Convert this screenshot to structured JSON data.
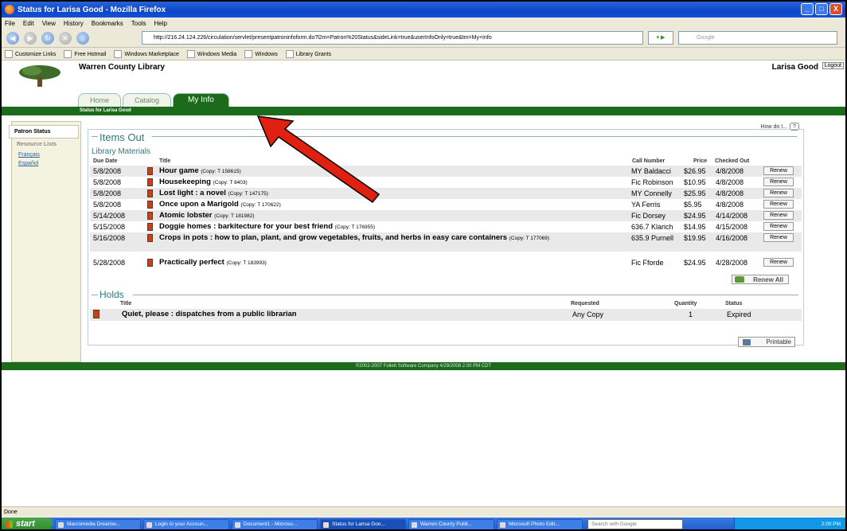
{
  "window": {
    "title": "Status for Larisa Good - Mozilla Firefox",
    "controls": [
      "_",
      "□",
      "X"
    ]
  },
  "menu": [
    "File",
    "Edit",
    "View",
    "History",
    "Bookmarks",
    "Tools",
    "Help"
  ],
  "nav": {
    "url": "http://216.24.124.226/circulation/servlet/presentpatroninfoform.do?l2m=Patron%20Status&sideLink=true&userInfoOnly=true&tm=My+Info",
    "search_placeholder": "Google"
  },
  "bookmarks": [
    "Customize Links",
    "Free Hotmail",
    "Windows Marketplace",
    "Windows Media",
    "Windows",
    "Library Grants"
  ],
  "header": {
    "library_name": "Warren County Library",
    "user_name": "Larisa Good",
    "logout_label": "Logout",
    "tabs": [
      "Home",
      "Catalog",
      "My Info"
    ],
    "breadcrumb": "Status for Larisa Good"
  },
  "sidebar": {
    "items": [
      "Patron Status",
      "Resource Lists"
    ],
    "languages": [
      "Français",
      "Español"
    ]
  },
  "help_label": "How do I...",
  "help_q": "?",
  "items_out": {
    "title": "Items Out",
    "subtitle": "Library Materials",
    "columns": {
      "due": "Due Date",
      "title": "Title",
      "call": "Call Number",
      "price": "Price",
      "checked": "Checked Out"
    },
    "rows": [
      {
        "due": "5/8/2008",
        "title": "Hour game",
        "copy": "(Copy: T 158615)",
        "call": "MY Baldacci",
        "price": "$26.95",
        "checked": "4/8/2008"
      },
      {
        "due": "5/8/2008",
        "title": "Housekeeping",
        "copy": "(Copy: T 8403)",
        "call": "Fic Robinson",
        "price": "$10.95",
        "checked": "4/8/2008"
      },
      {
        "due": "5/8/2008",
        "title": "Lost light : a novel",
        "copy": "(Copy: T 147175)",
        "call": "MY Connelly",
        "price": "$25.95",
        "checked": "4/8/2008"
      },
      {
        "due": "5/8/2008",
        "title": "Once upon a Marigold",
        "copy": "(Copy: T 170622)",
        "call": "YA Ferris",
        "price": "$5.95",
        "checked": "4/8/2008"
      },
      {
        "due": "5/14/2008",
        "title": "Atomic lobster",
        "copy": "(Copy: T 181982)",
        "call": "Fic Dorsey",
        "price": "$24.95",
        "checked": "4/14/2008"
      },
      {
        "due": "5/15/2008",
        "title": "Doggie homes : barkitecture for your best friend",
        "copy": "(Copy: T 176955)",
        "call": "636.7 Klarich",
        "price": "$14.95",
        "checked": "4/15/2008"
      },
      {
        "due": "5/16/2008",
        "title": "Crops in pots : how to plan, plant, and grow vegetables, fruits, and herbs in easy care containers",
        "copy": "(Copy: T 177069)",
        "call": "635.9 Purnell",
        "price": "$19.95",
        "checked": "4/16/2008"
      },
      {
        "due": "5/28/2008",
        "title": "Practically perfect",
        "copy": "(Copy: T 183993)",
        "call": "Fic Fforde",
        "price": "$24.95",
        "checked": "4/28/2008"
      }
    ],
    "renew_label": "Renew",
    "renew_all_label": "Renew All"
  },
  "holds": {
    "title": "Holds",
    "columns": {
      "title": "Title",
      "requested": "Requested",
      "quantity": "Quantity",
      "status": "Status"
    },
    "rows": [
      {
        "title": "Quiet, please : dispatches from a public librarian",
        "requested": "Any Copy",
        "quantity": "1",
        "status": "Expired"
      }
    ]
  },
  "printable_label": "Printable",
  "footer": "©2002-2007 Follett Software Company     4/29/2008 2:00 PM CDT",
  "status": "Done",
  "taskbar": {
    "start": "start",
    "tasks": [
      "Macromedia Dreamw...",
      "Login to your Accoun...",
      "Document1 - Microso...",
      "Status for Larisa Goo...",
      "Warren County Publi...",
      "Microsoft Photo Edit..."
    ],
    "search": "Search with Google",
    "clock": "2:00 PM"
  },
  "colors": {
    "green": "#1c6b1c",
    "teal": "#2f7a7a",
    "arrow": "#e02010"
  }
}
